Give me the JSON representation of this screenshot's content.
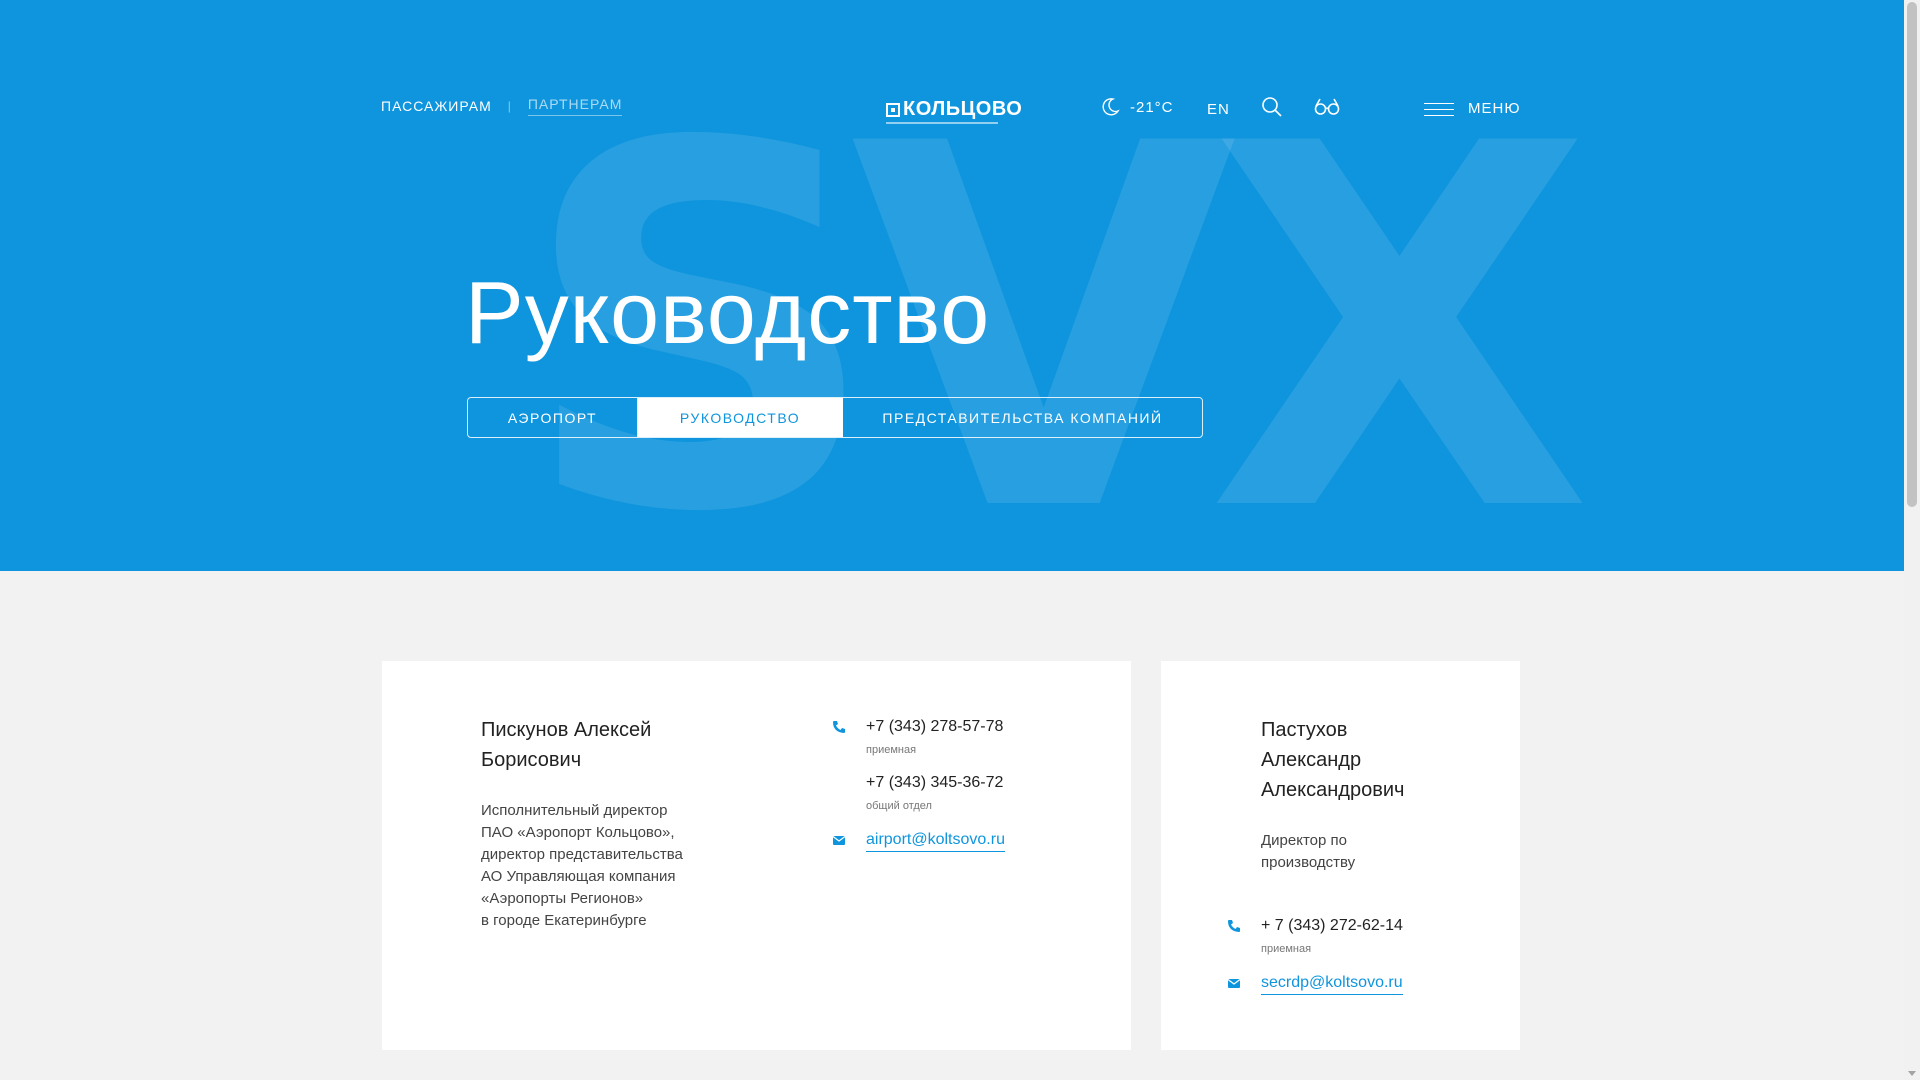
{
  "colors": {
    "accent": "#0f95dd",
    "background": "#f2f2f2",
    "card": "#ffffff"
  },
  "header": {
    "nav_passengers": "ПАССАЖИРАМ",
    "nav_separator": "|",
    "nav_partners": "ПАРТНЕРАМ",
    "logo": "КОЛЬЦОВО",
    "weather_temp": "-21°С",
    "weather_icon": "moon-icon",
    "lang": "EN",
    "search_icon": "search-icon",
    "accessibility_icon": "glasses-icon",
    "menu_label": "МЕНЮ"
  },
  "hero": {
    "watermark": "SVX",
    "title": "Руководство",
    "tabs": [
      {
        "label": "АЭРОПОРТ",
        "active": false
      },
      {
        "label": "РУКОВОДСТВО",
        "active": true
      },
      {
        "label": "ПРЕДСТАВИТЕЛЬСТВА КОМПАНИЙ",
        "active": false
      }
    ]
  },
  "people": [
    {
      "name_line1": "Пискунов Алексей",
      "name_line2": "Борисович",
      "role_lines": [
        "Исполнительный директор",
        "ПАО «Аэропорт Кольцово»,",
        "директор представительства",
        "АО Управляющая компания",
        "«Аэропорты Регионов»",
        "в городе Екатеринбурге"
      ],
      "phones": [
        {
          "number": "+7 (343) 278-57-78",
          "note": "приемная"
        },
        {
          "number": "+7 (343) 345-36-72",
          "note": "общий отдел"
        }
      ],
      "email": "airport@koltsovo.ru"
    },
    {
      "name_line1": "Пастухов",
      "name_line2": "Александр",
      "name_line3": "Александрович",
      "role_lines": [
        "Директор по",
        "производству"
      ],
      "phones": [
        {
          "number": "+ 7 (343) 272-62-14",
          "note": "приемная"
        }
      ],
      "email": "secrdp@koltsovo.ru"
    }
  ]
}
